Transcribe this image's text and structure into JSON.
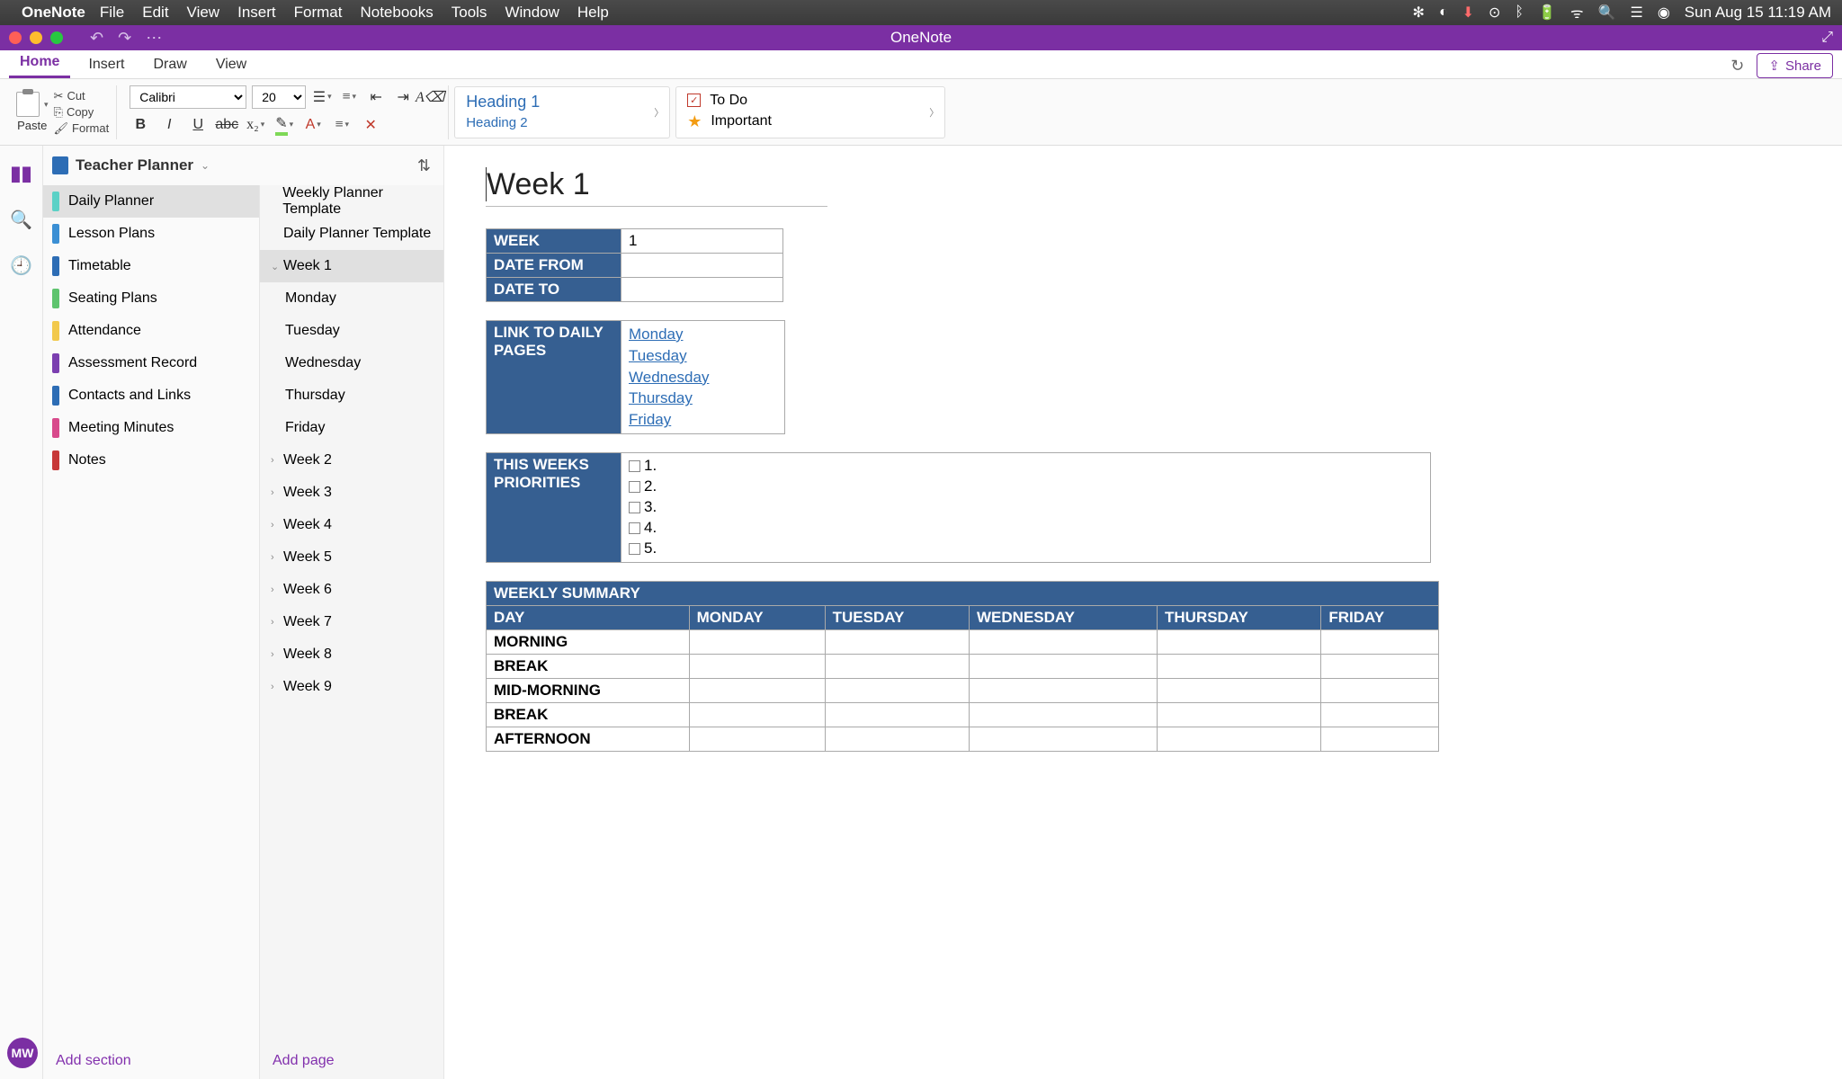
{
  "mac": {
    "app": "OneNote",
    "menus": [
      "File",
      "Edit",
      "View",
      "Insert",
      "Format",
      "Notebooks",
      "Tools",
      "Window",
      "Help"
    ],
    "clock": "Sun Aug 15  11:19 AM"
  },
  "window": {
    "title": "OneNote"
  },
  "ribbon": {
    "tabs": [
      "Home",
      "Insert",
      "Draw",
      "View"
    ],
    "active": "Home",
    "share": "Share",
    "paste": "Paste",
    "cut": "Cut",
    "copy": "Copy",
    "format": "Format",
    "font_name": "Calibri",
    "font_size": "20",
    "styles": {
      "h1": "Heading 1",
      "h2": "Heading 2"
    },
    "tags": {
      "todo": "To Do",
      "important": "Important"
    }
  },
  "notebook": {
    "name": "Teacher Planner",
    "sections": [
      {
        "label": "Daily Planner",
        "color": "#5bd1c6"
      },
      {
        "label": "Lesson Plans",
        "color": "#3b8fd4"
      },
      {
        "label": "Timetable",
        "color": "#2d6db5"
      },
      {
        "label": "Seating Plans",
        "color": "#5ec46e"
      },
      {
        "label": "Attendance",
        "color": "#f2c94c"
      },
      {
        "label": "Assessment Record",
        "color": "#7b3fb0"
      },
      {
        "label": "Contacts and Links",
        "color": "#2d6db5"
      },
      {
        "label": "Meeting Minutes",
        "color": "#d84a8c"
      },
      {
        "label": "Notes",
        "color": "#c73838"
      }
    ],
    "active_section": 0,
    "pages": [
      {
        "label": "Weekly Planner Template",
        "level": 0
      },
      {
        "label": "Daily Planner Template",
        "level": 0
      },
      {
        "label": "Week 1",
        "level": 0,
        "expanded": true
      },
      {
        "label": "Monday",
        "level": 1
      },
      {
        "label": "Tuesday",
        "level": 1
      },
      {
        "label": "Wednesday",
        "level": 1
      },
      {
        "label": "Thursday",
        "level": 1
      },
      {
        "label": "Friday",
        "level": 1
      },
      {
        "label": "Week 2",
        "level": 0,
        "collapsed": true
      },
      {
        "label": "Week 3",
        "level": 0,
        "collapsed": true
      },
      {
        "label": "Week 4",
        "level": 0,
        "collapsed": true
      },
      {
        "label": "Week 5",
        "level": 0,
        "collapsed": true
      },
      {
        "label": "Week 6",
        "level": 0,
        "collapsed": true
      },
      {
        "label": "Week 7",
        "level": 0,
        "collapsed": true
      },
      {
        "label": "Week 8",
        "level": 0,
        "collapsed": true
      },
      {
        "label": "Week 9",
        "level": 0,
        "collapsed": true
      }
    ],
    "active_page": 2,
    "add_section": "Add section",
    "add_page": "Add page"
  },
  "page": {
    "title": "Week 1",
    "info": [
      {
        "label": "WEEK",
        "value": "1"
      },
      {
        "label": "DATE FROM",
        "value": ""
      },
      {
        "label": "DATE TO",
        "value": ""
      }
    ],
    "links_label": "LINK TO DAILY PAGES",
    "links": [
      "Monday",
      "Tuesday",
      "Wednesday",
      "Thursday",
      "Friday"
    ],
    "priorities_label": "THIS WEEKS PRIORITIES",
    "priorities": [
      "1.",
      "2.",
      "3.",
      "4.",
      "5."
    ],
    "summary": {
      "title": "WEEKLY SUMMARY",
      "cols": [
        "DAY",
        "MONDAY",
        "TUESDAY",
        "WEDNESDAY",
        "THURSDAY",
        "FRIDAY"
      ],
      "rows": [
        "MORNING",
        "BREAK",
        "MID-MORNING",
        "BREAK",
        "AFTERNOON"
      ]
    }
  },
  "avatar": "MW"
}
